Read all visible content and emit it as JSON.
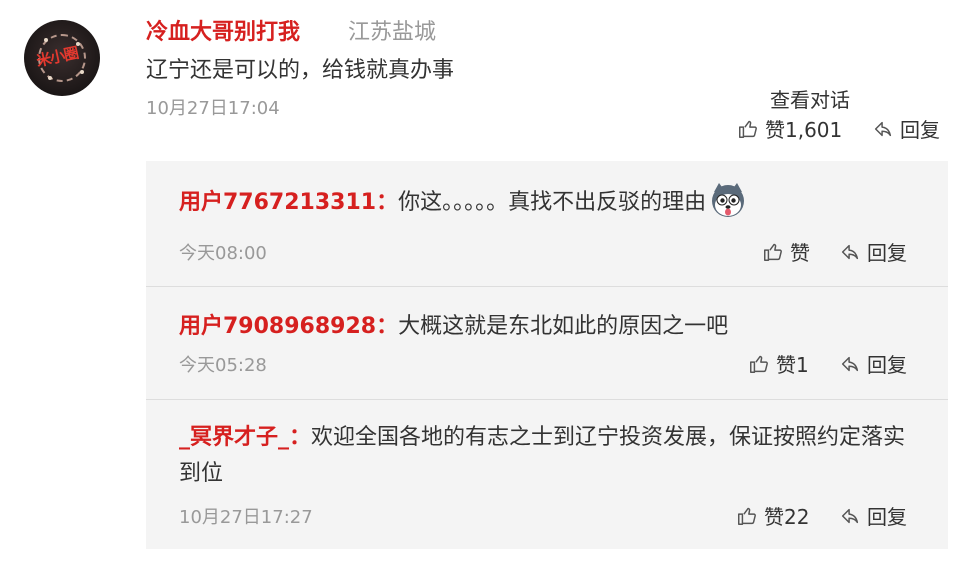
{
  "comment": {
    "author": "冷血大哥别打我",
    "location": "江苏盐城",
    "text": "辽宁还是可以的，给钱就真办事",
    "time": "10月27日17:04",
    "view_conversation": "查看对话",
    "like_label": "赞1,601",
    "reply_label": "回复",
    "avatar_text": "米小圈"
  },
  "replies": [
    {
      "user": "用户7767213311：",
      "text": "你这。。。。。真找不出反驳的理由",
      "emoji": "husky-emoji",
      "time": "今天08:00",
      "like_label": "赞",
      "reply_label": "回复"
    },
    {
      "user": "用户7908968928：",
      "text": "大概这就是东北如此的原因之一吧",
      "time": "今天05:28",
      "like_label": "赞1",
      "reply_label": "回复"
    },
    {
      "user": "_冥界才子_：",
      "text": "欢迎全国各地的有志之士到辽宁投资发展，保证按照约定落实到位",
      "time": "10月27日17:27",
      "like_label": "赞22",
      "reply_label": "回复"
    }
  ],
  "colors": {
    "username": "#d6201f",
    "muted": "#999999",
    "text": "#333333",
    "reply_bg": "#f4f4f4"
  },
  "icons": {
    "like": "thumbs-up-icon",
    "reply": "reply-arrow-icon"
  }
}
